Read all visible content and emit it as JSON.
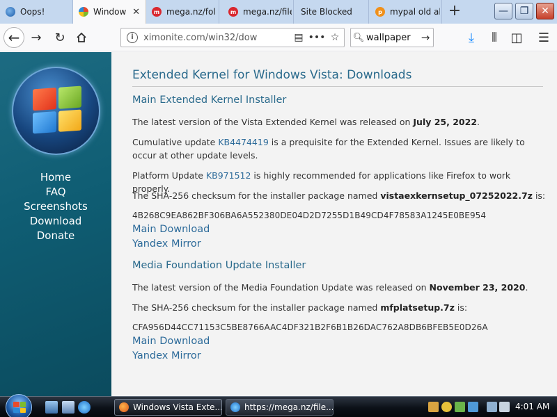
{
  "browser": {
    "tabs": [
      {
        "title": "Oops!",
        "favicon": "blue-swirl-icon",
        "active": false
      },
      {
        "title": "Windows Vista Extended Kernel",
        "favicon": "windows-logo-icon",
        "active": true
      },
      {
        "title": "mega.nz/folder",
        "favicon": "mega-icon",
        "active": false
      },
      {
        "title": "mega.nz/file",
        "favicon": "mega-icon",
        "active": false
      },
      {
        "title": "Site Blocked",
        "favicon": "",
        "active": false
      },
      {
        "title": "mypal old al",
        "favicon": "orange-icon",
        "active": false
      }
    ],
    "new_tab": "+",
    "window_controls": {
      "minimize": "—",
      "restore": "❐",
      "close": "✕"
    }
  },
  "navbar": {
    "url": "ximonite.com/win32/dow",
    "search_value": "wallpaper"
  },
  "sidebar": {
    "nav": [
      "Home",
      "FAQ",
      "Screenshots",
      "Download",
      "Donate"
    ]
  },
  "page": {
    "title": "Extended Kernel for Windows Vista: Downloads",
    "kernel": {
      "heading": "Main Extended Kernel Installer",
      "p1_pre": "The latest version of the Vista Extended Kernel was released on ",
      "p1_date": "July 25, 2022",
      "p1_post": ".",
      "p2_pre": "Cumulative update ",
      "p2_link": "KB4474419",
      "p2_post": " is a prequisite for the Extended Kernel. Issues are likely to occur at other update levels.",
      "p3_pre": "Platform Update ",
      "p3_link": "KB971512",
      "p3_post": " is highly recommended for applications like Firefox to work properly.",
      "p4_pre": "The SHA-256 checksum for the installer package named ",
      "p4_file": "vistaexkernsetup_07252022.7z",
      "p4_post": " is:",
      "hash": "4B268C9EA862BF306BA6A552380DE04D2D7255D1B49CD4F78583A1245E0BE954",
      "main_download": "Main Download",
      "yandex_mirror": "Yandex Mirror"
    },
    "mf": {
      "heading": "Media Foundation Update Installer",
      "p1_pre": "The latest version of the Media Foundation Update was released on ",
      "p1_date": "November 23, 2020",
      "p1_post": ".",
      "p2_pre": "The SHA-256 checksum for the installer package named ",
      "p2_file": "mfplatsetup.7z",
      "p2_post": " is:",
      "hash": "CFA956D44CC71153C5BE8766AAC4DF321B2F6B1B26DAC762A8DB6BFEB5E0D26A",
      "main_download": "Main Download",
      "yandex_mirror": "Yandex Mirror"
    }
  },
  "taskbar": {
    "tasks": [
      {
        "title": "Windows Vista Exte...",
        "icon": "firefox-icon"
      },
      {
        "title": "https://mega.nz/file...",
        "icon": "ie-icon"
      }
    ],
    "clock": "4:01 AM"
  },
  "colors": {
    "sidebar": "#13667c",
    "link": "#2d6b9a",
    "heading": "#2a6a8c",
    "tabstrip": "#c5d8ef"
  }
}
